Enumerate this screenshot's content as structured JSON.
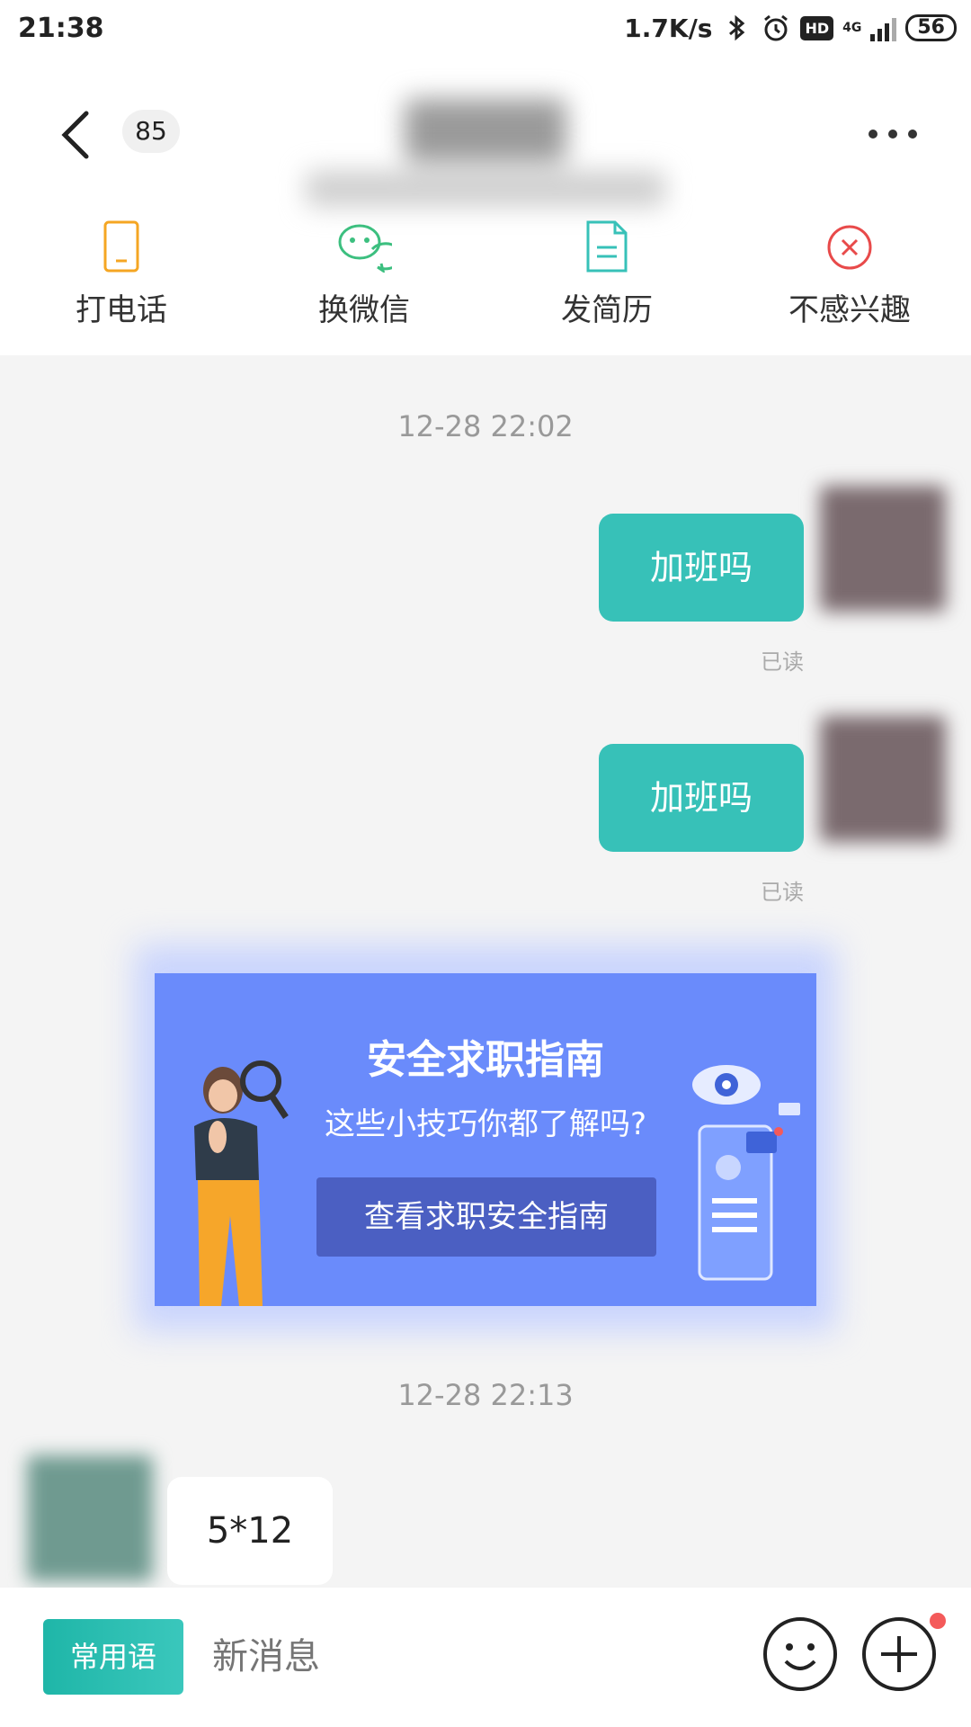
{
  "status": {
    "time": "21:38",
    "speed": "1.7K/s",
    "hd": "HD",
    "network": "4G",
    "battery": "56"
  },
  "header": {
    "unread_count": "85"
  },
  "actions": [
    {
      "label": "打电话",
      "icon": "phone-icon",
      "color": "#f5a623"
    },
    {
      "label": "换微信",
      "icon": "wechat-icon",
      "color": "#3cbf7f"
    },
    {
      "label": "发简历",
      "icon": "resume-icon",
      "color": "#37c1b8"
    },
    {
      "label": "不感兴趣",
      "icon": "not-interested-icon",
      "color": "#e84a4a"
    }
  ],
  "chat": {
    "timestamp_1": "12-28 22:02",
    "messages_out": [
      {
        "text": "加班吗",
        "status": "已读"
      },
      {
        "text": "加班吗",
        "status": "已读"
      }
    ],
    "card": {
      "title": "安全求职指南",
      "subtitle": "这些小技巧你都了解吗?",
      "button": "查看求职安全指南"
    },
    "timestamp_2": "12-28 22:13",
    "message_in": {
      "text": "5*12"
    }
  },
  "input_bar": {
    "quick_phrases_label": "常用语",
    "placeholder": "新消息"
  },
  "colors": {
    "accent": "#37c1b8",
    "card_bg": "#6a8bfb",
    "card_button": "#4b5fc2"
  }
}
